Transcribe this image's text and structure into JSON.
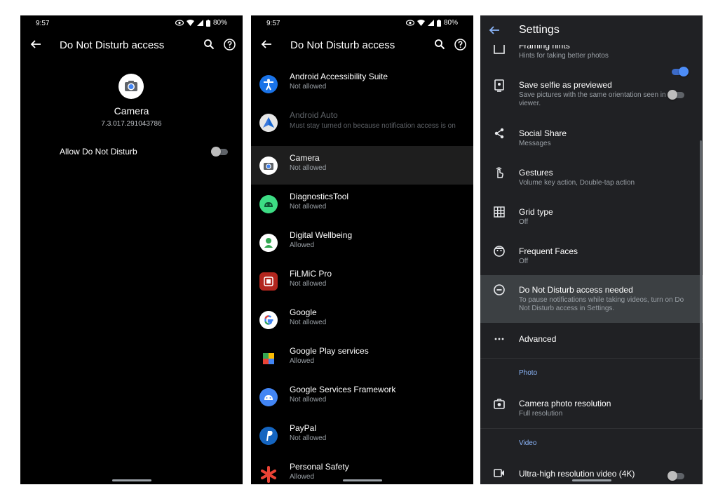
{
  "panel1": {
    "status": {
      "time": "9:57",
      "battery": "80%"
    },
    "appbar": {
      "title": "Do Not Disturb access"
    },
    "app": {
      "name": "Camera",
      "version": "7.3.017.291043786"
    },
    "setting": {
      "label": "Allow Do Not Disturb",
      "enabled": false
    }
  },
  "panel2": {
    "status": {
      "time": "9:57",
      "battery": "80%"
    },
    "appbar": {
      "title": "Do Not Disturb access"
    },
    "apps": [
      {
        "name": "Android Accessibility Suite",
        "status": "Not allowed"
      },
      {
        "name": "Android Auto",
        "status": "Must stay turned on because notification access is on"
      },
      {
        "name": "Camera",
        "status": "Not allowed"
      },
      {
        "name": "DiagnosticsTool",
        "status": "Not allowed"
      },
      {
        "name": "Digital Wellbeing",
        "status": "Allowed"
      },
      {
        "name": "FiLMiC Pro",
        "status": "Not allowed"
      },
      {
        "name": "Google",
        "status": "Not allowed"
      },
      {
        "name": "Google Play services",
        "status": "Allowed"
      },
      {
        "name": "Google Services Framework",
        "status": "Not allowed"
      },
      {
        "name": "PayPal",
        "status": "Not allowed"
      },
      {
        "name": "Personal Safety",
        "status": "Allowed"
      }
    ]
  },
  "panel3": {
    "header": {
      "title": "Settings"
    },
    "items": [
      {
        "name": "Framing hints",
        "summary": "Hints for taking better photos",
        "toggle": true
      },
      {
        "name": "Save selfie as previewed",
        "summary": "Save pictures with the same orientation seen in the viewer.",
        "toggle": false
      },
      {
        "name": "Social Share",
        "summary": "Messages"
      },
      {
        "name": "Gestures",
        "summary": "Volume key action, Double-tap action"
      },
      {
        "name": "Grid type",
        "summary": "Off"
      },
      {
        "name": "Frequent Faces",
        "summary": "Off"
      },
      {
        "name": "Do Not Disturb access needed",
        "summary": "To pause notifications while taking videos, turn on Do Not Disturb access in Settings."
      },
      {
        "name": "Advanced",
        "summary": ""
      }
    ],
    "categories": {
      "photo": "Photo",
      "video": "Video"
    },
    "photo_resolution": {
      "name": "Camera photo resolution",
      "summary": "Full resolution"
    },
    "video_item": {
      "name": "Ultra-high resolution video (4K)"
    }
  },
  "colors": {
    "accent": "#8ab4f8",
    "toggle_on": "#4d8df7",
    "highlight": "#3c4043"
  }
}
